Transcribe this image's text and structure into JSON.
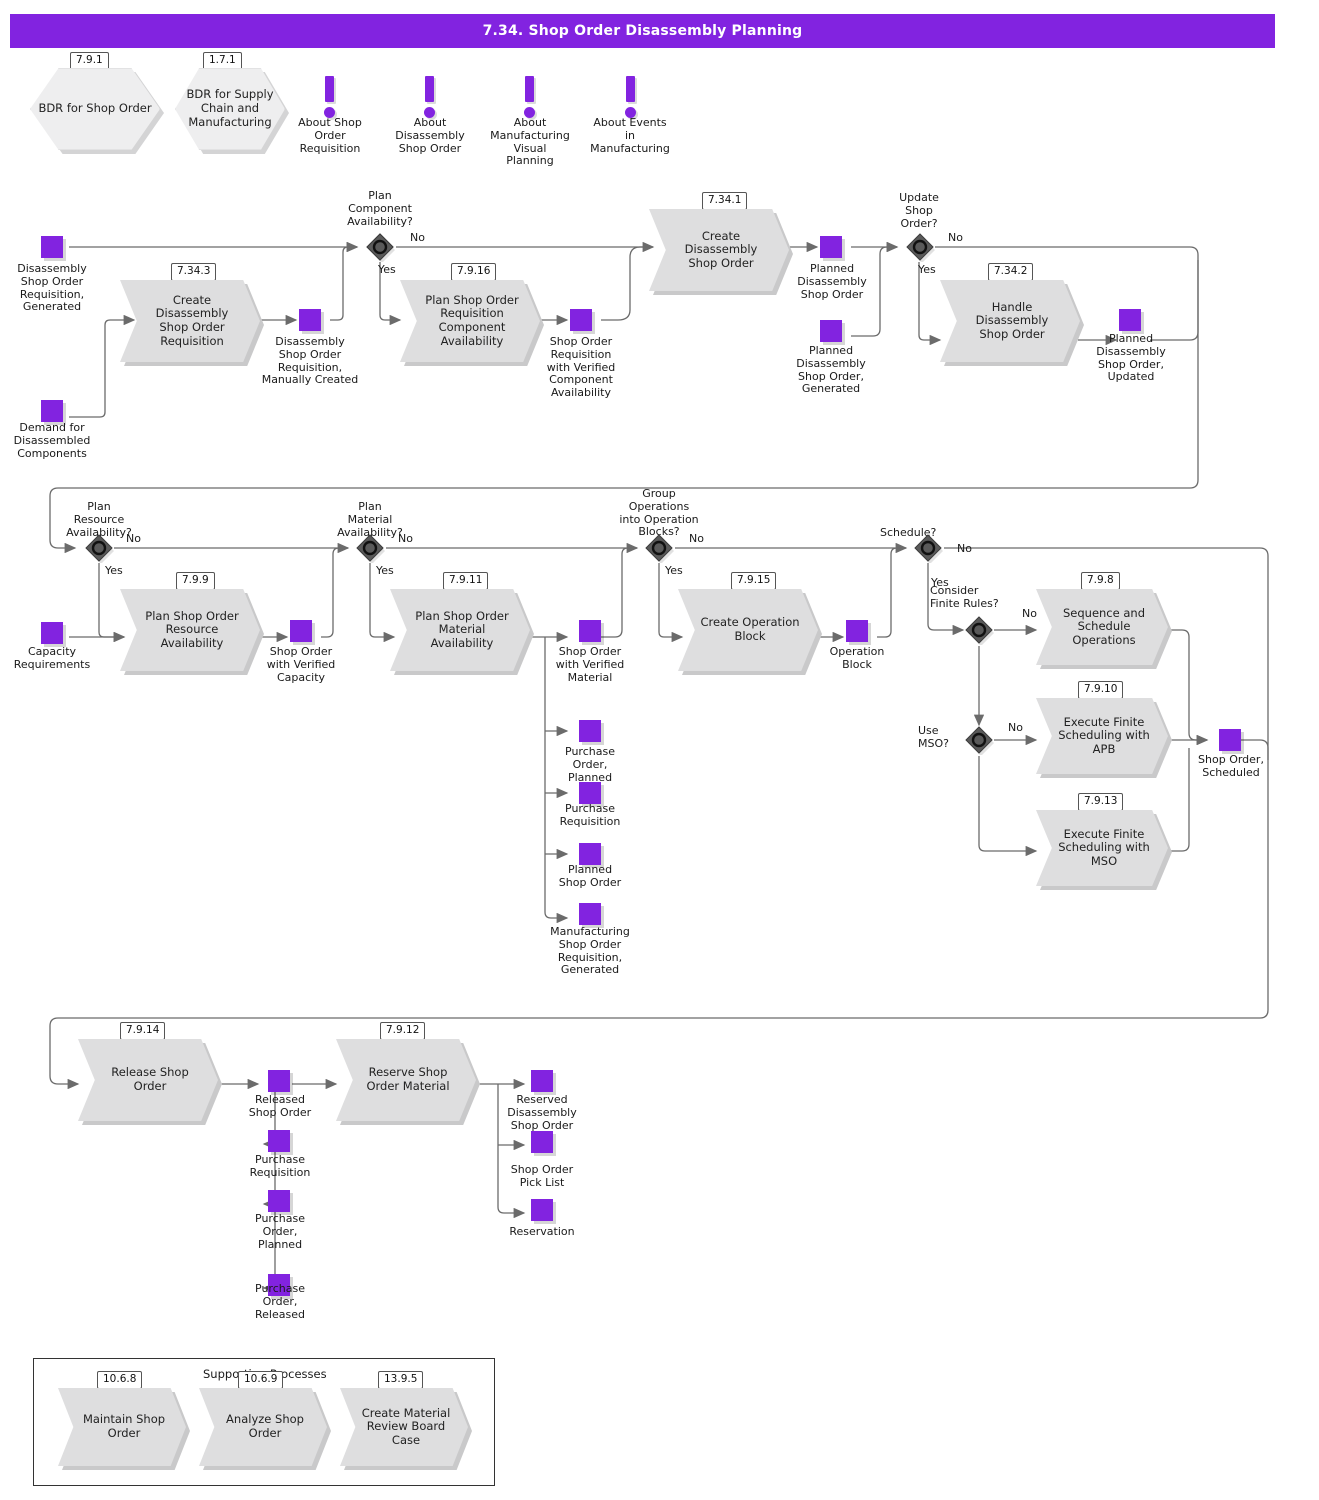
{
  "title": "7.34. Shop Order Disassembly Planning",
  "colors": {
    "accent": "#8223e0",
    "process_fill": "#dededf",
    "hex_fill": "#eeeeef",
    "diamond_fill": "#5a5a5a",
    "line": "#6b6b6b"
  },
  "top_row": {
    "bdr": [
      {
        "code": "7.9.1",
        "label": "BDR for Shop Order"
      },
      {
        "code": "1.7.1",
        "label": "BDR for Supply\nChain and\nManufacturing"
      }
    ],
    "about": [
      {
        "label": "About Shop\nOrder\nRequisition"
      },
      {
        "label": "About\nDisassembly\nShop Order"
      },
      {
        "label": "About\nManufacturing\nVisual\nPlanning"
      },
      {
        "label": "About Events\nin\nManufacturing"
      }
    ]
  },
  "row1": {
    "inputs": [
      {
        "label": "Disassembly\nShop Order\nRequisition,\nGenerated"
      },
      {
        "label": "Demand for\nDisassembled\nComponents"
      }
    ],
    "processes": [
      {
        "code": "7.34.3",
        "label": "Create\nDisassembly\nShop Order\nRequisition"
      },
      {
        "code": "7.9.16",
        "label": "Plan Shop Order\nRequisition\nComponent\nAvailability"
      },
      {
        "code": "7.34.1",
        "label": "Create\nDisassembly\nShop Order"
      },
      {
        "code": "7.34.2",
        "label": "Handle\nDisassembly\nShop Order"
      }
    ],
    "decisions": [
      {
        "question": "Plan\nComponent\nAvailability?",
        "yes": "Yes",
        "no": "No"
      },
      {
        "question": "Update\nShop\nOrder?",
        "yes": "Yes",
        "no": "No"
      }
    ],
    "objects": [
      {
        "label": "Disassembly\nShop Order\nRequisition,\nManually Created"
      },
      {
        "label": "Shop Order\nRequisition\nwith Verified\nComponent\nAvailability"
      },
      {
        "label": "Planned\nDisassembly\nShop Order"
      },
      {
        "label": "Planned\nDisassembly\nShop Order,\nGenerated"
      },
      {
        "label": "Planned\nDisassembly\nShop Order,\nUpdated"
      }
    ]
  },
  "row2": {
    "inputs": [
      {
        "label": "Capacity\nRequirements"
      }
    ],
    "decisions": [
      {
        "question": "Plan\nResource\nAvailability?",
        "yes": "Yes",
        "no": "No"
      },
      {
        "question": "Plan\nMaterial\nAvailability?",
        "yes": "Yes",
        "no": "No"
      },
      {
        "question": "Group\nOperations\ninto Operation\nBlocks?",
        "yes": "Yes",
        "no": "No"
      },
      {
        "question": "Schedule?",
        "yes": "Yes",
        "no": "No"
      },
      {
        "question": "Consider\nFinite Rules?",
        "no": "No"
      },
      {
        "question": "Use\nMSO?",
        "no": "No"
      }
    ],
    "processes": [
      {
        "code": "7.9.9",
        "label": "Plan Shop Order\nResource\nAvailability"
      },
      {
        "code": "7.9.11",
        "label": "Plan Shop Order\nMaterial\nAvailability"
      },
      {
        "code": "7.9.15",
        "label": "Create\nOperation Block"
      },
      {
        "code": "7.9.8",
        "label": "Sequence and\nSchedule\nOperations"
      },
      {
        "code": "7.9.10",
        "label": "Execute Finite\nScheduling with\nAPB"
      },
      {
        "code": "7.9.13",
        "label": "Execute Finite\nScheduling with\nMSO"
      }
    ],
    "objects": [
      {
        "label": "Shop Order\nwith Verified\nCapacity"
      },
      {
        "label": "Shop Order\nwith Verified\nMaterial"
      },
      {
        "label": "Purchase\nOrder,\nPlanned"
      },
      {
        "label": "Purchase\nRequisition"
      },
      {
        "label": "Planned\nShop Order"
      },
      {
        "label": "Manufacturing\nShop Order\nRequisition,\nGenerated"
      },
      {
        "label": "Operation\nBlock"
      },
      {
        "label": "Shop Order,\nScheduled"
      }
    ]
  },
  "row3": {
    "processes": [
      {
        "code": "7.9.14",
        "label": "Release Shop\nOrder"
      },
      {
        "code": "7.9.12",
        "label": "Reserve Shop\nOrder Material"
      }
    ],
    "objects": [
      {
        "label": "Released\nShop Order"
      },
      {
        "label": "Purchase\nRequisition"
      },
      {
        "label": "Purchase\nOrder,\nPlanned"
      },
      {
        "label": "Purchase\nOrder,\nReleased"
      },
      {
        "label": "Reserved\nDisassembly\nShop Order"
      },
      {
        "label": "Shop Order\nPick List"
      },
      {
        "label": "Reservation"
      }
    ]
  },
  "supporting": {
    "title": "Supporting Processes",
    "processes": [
      {
        "code": "10.6.8",
        "label": "Maintain Shop\nOrder"
      },
      {
        "code": "10.6.9",
        "label": "Analyze Shop\nOrder"
      },
      {
        "code": "13.9.5",
        "label": "Create Material\nReview Board\nCase"
      }
    ]
  }
}
